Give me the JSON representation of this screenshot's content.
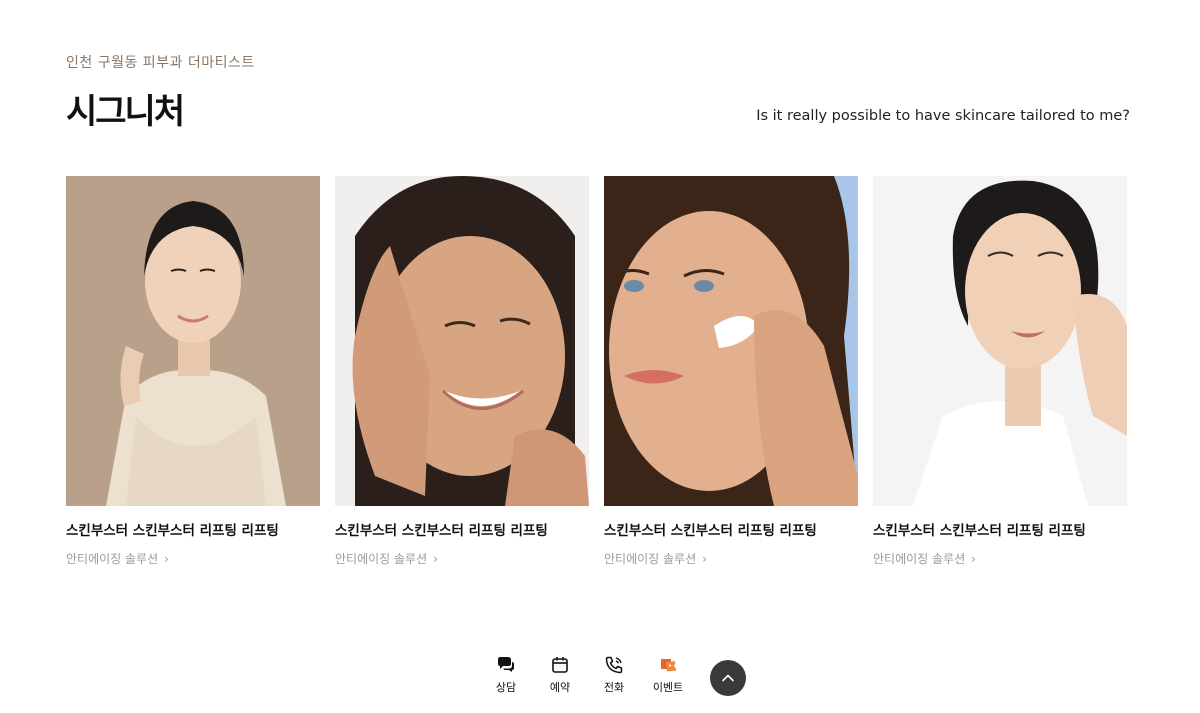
{
  "section": {
    "eyebrow": "인천 구월동 피부과 더마티스트",
    "title": "시그니처",
    "tagline": "Is it really possible to have skincare tailored to me?"
  },
  "cards": [
    {
      "title": "스킨부스터 스킨부스터 리프팅 리프팅",
      "subtitle": "안티에이징 솔루션",
      "bg": "#b8a08a"
    },
    {
      "title": "스킨부스터 스킨부스터 리프팅 리프팅",
      "subtitle": "안티에이징 솔루션",
      "bg": "#f2f0ee"
    },
    {
      "title": "스킨부스터 스킨부스터 리프팅 리프팅",
      "subtitle": "안티에이징 솔루션",
      "bg": "#a9c6e6"
    },
    {
      "title": "스킨부스터 스킨부스터 리프팅 리프팅",
      "subtitle": "안티에이징 솔루션",
      "bg": "#f3f3f3"
    }
  ],
  "quick_bar": {
    "items": [
      {
        "label": "상담",
        "icon": "chat-bubbles-icon"
      },
      {
        "label": "예약",
        "icon": "calendar-icon"
      },
      {
        "label": "전화",
        "icon": "phone-icon"
      },
      {
        "label": "이벤트",
        "icon": "event-ticket-icon"
      }
    ],
    "top_button_icon": "chevron-up-icon"
  },
  "colors": {
    "eyebrow": "#8a7766",
    "event_accent": "#e8622c",
    "top_button": "#3a3a3a"
  }
}
